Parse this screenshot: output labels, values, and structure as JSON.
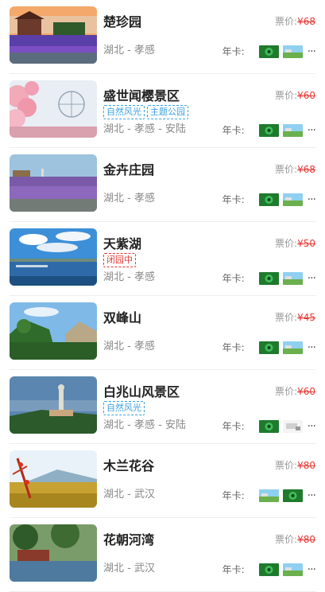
{
  "price_label": "票价:",
  "card_label": "年卡:",
  "more_label": "···",
  "items": [
    {
      "name": "楚珍园",
      "price": "¥68",
      "tags": [],
      "location": "湖北 - 孝感"
    },
    {
      "name": "盛世闻樱景区",
      "price": "¥60",
      "tags": [
        {
          "text": "自然风光",
          "color": "blue"
        },
        {
          "text": "主题公园",
          "color": "blue"
        }
      ],
      "location": "湖北 - 孝感 - 安陆"
    },
    {
      "name": "金卉庄园",
      "price": "¥68",
      "tags": [],
      "location": "湖北 - 孝感"
    },
    {
      "name": "天紫湖",
      "price": "¥50",
      "tags": [
        {
          "text": "闭园中",
          "color": "red"
        }
      ],
      "location": "湖北 - 孝感"
    },
    {
      "name": "双峰山",
      "price": "¥45",
      "tags": [],
      "location": "湖北 - 孝感"
    },
    {
      "name": "白兆山风景区",
      "price": "¥60",
      "tags": [
        {
          "text": "自然风光",
          "color": "blue"
        }
      ],
      "location": "湖北 - 孝感 - 安陆"
    },
    {
      "name": "木兰花谷",
      "price": "¥80",
      "tags": [],
      "location": "湖北 - 武汉"
    },
    {
      "name": "花朝河湾",
      "price": "¥80",
      "tags": [],
      "location": "湖北 - 武汉"
    }
  ]
}
